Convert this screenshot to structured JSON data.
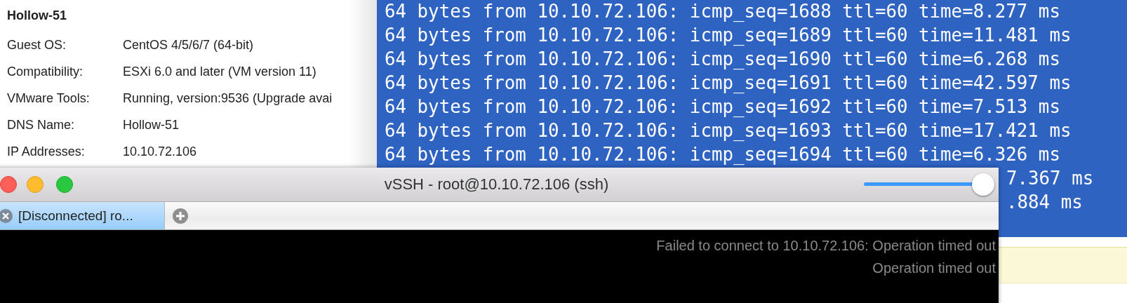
{
  "vm_summary": {
    "title": "Hollow-51",
    "fields": [
      {
        "label": "Guest OS:",
        "value": "CentOS 4/5/6/7 (64-bit)"
      },
      {
        "label": "Compatibility:",
        "value": "ESXi 6.0 and later (VM version 11)"
      },
      {
        "label": "VMware Tools:",
        "value": "Running, version:9536 (Upgrade avai"
      },
      {
        "label": "DNS Name:",
        "value": "Hollow-51"
      },
      {
        "label": "IP Addresses:",
        "value": "10.10.72.106"
      }
    ]
  },
  "terminal": {
    "lines": [
      {
        "kind": "full",
        "text": "64 bytes from 10.10.72.106: icmp_seq=1688 ttl=60 time=8.277 ms"
      },
      {
        "kind": "full",
        "text": "64 bytes from 10.10.72.106: icmp_seq=1689 ttl=60 time=11.481 ms"
      },
      {
        "kind": "full",
        "text": "64 bytes from 10.10.72.106: icmp_seq=1690 ttl=60 time=6.268 ms"
      },
      {
        "kind": "full",
        "text": "64 bytes from 10.10.72.106: icmp_seq=1691 ttl=60 time=42.597 ms"
      },
      {
        "kind": "full",
        "text": "64 bytes from 10.10.72.106: icmp_seq=1692 ttl=60 time=7.513 ms"
      },
      {
        "kind": "full",
        "text": "64 bytes from 10.10.72.106: icmp_seq=1693 ttl=60 time=17.421 ms"
      },
      {
        "kind": "full",
        "text": "64 bytes from 10.10.72.106: icmp_seq=1694 ttl=60 time=6.326 ms"
      },
      {
        "kind": "tail",
        "text": "7.367 ms"
      },
      {
        "kind": "tail",
        "text": ".884 ms"
      }
    ]
  },
  "ssh_window": {
    "title": "vSSH - root@10.10.72.106 (ssh)",
    "slider": {
      "level": 1
    },
    "tabs": [
      {
        "label": "[Disconnected] ro...",
        "selected": true
      }
    ],
    "output": [
      "Failed to connect to 10.10.72.106: Operation timed out",
      "Operation timed out"
    ]
  }
}
